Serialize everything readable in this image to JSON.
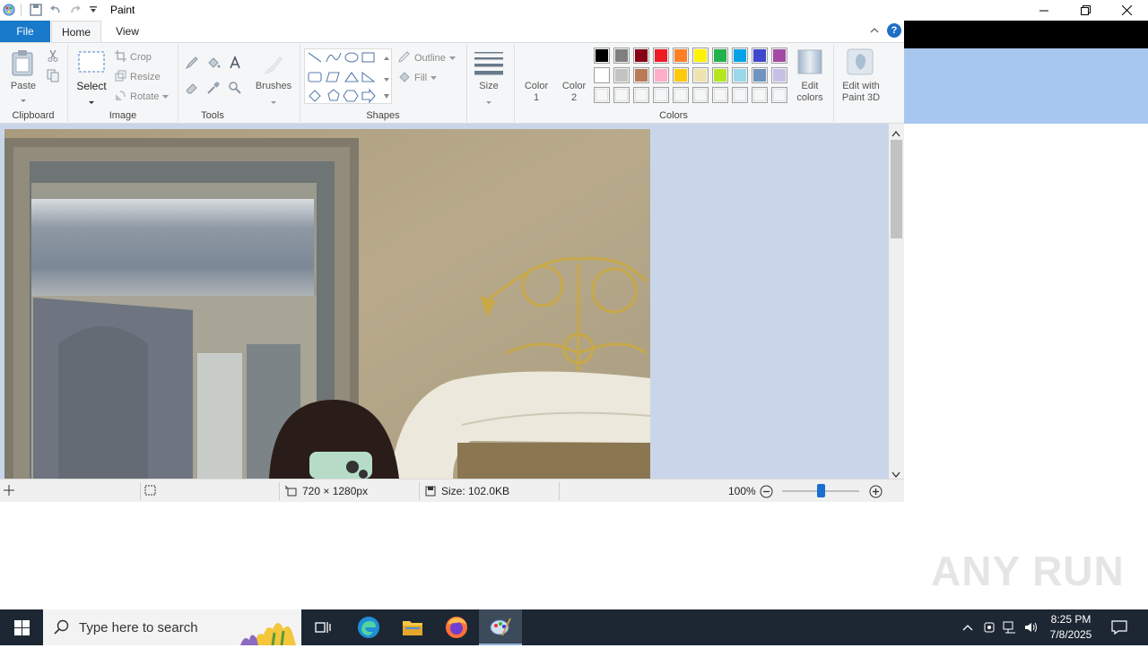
{
  "app": {
    "title": "Paint"
  },
  "tabs": {
    "file": "File",
    "home": "Home",
    "view": "View"
  },
  "ribbon": {
    "clipboard": {
      "paste": "Paste",
      "group": "Clipboard"
    },
    "image": {
      "select": "Select",
      "crop": "Crop",
      "resize": "Resize",
      "rotate": "Rotate",
      "group": "Image"
    },
    "tools": {
      "group": "Tools"
    },
    "brushes": {
      "label": "Brushes"
    },
    "shapes": {
      "outline": "Outline",
      "fill": "Fill",
      "group": "Shapes"
    },
    "size": {
      "label": "Size"
    },
    "colors": {
      "color1_line1": "Color",
      "color1_line2": "1",
      "color2_line1": "Color",
      "color2_line2": "2",
      "edit_line1": "Edit",
      "edit_line2": "colors",
      "paint3d_line1": "Edit with",
      "paint3d_line2": "Paint 3D",
      "group": "Colors",
      "palette_row1": [
        "#000000",
        "#7f7f7f",
        "#880015",
        "#ed1c24",
        "#ff7f27",
        "#fff200",
        "#22b14c",
        "#00a2e8",
        "#3f48cc",
        "#a349a4"
      ],
      "palette_row2": [
        "#ffffff",
        "#c3c3c3",
        "#b97a57",
        "#ffaec9",
        "#ffc90e",
        "#efe4b0",
        "#b5e61d",
        "#99d9ea",
        "#7092be",
        "#c8bfe7"
      ]
    }
  },
  "status": {
    "dimensions": "720 × 1280px",
    "size": "Size: 102.0KB",
    "zoom": "100%"
  },
  "taskbar": {
    "search_placeholder": "Type here to search",
    "time": "8:25 PM",
    "date": "7/8/2025"
  },
  "watermark": "ANY RUN",
  "icons": [
    "paint-app-icon",
    "save-icon",
    "undo-icon",
    "redo-icon",
    "customize-icon",
    "minimize-icon",
    "restore-icon",
    "close-icon",
    "help-icon",
    "collapse-ribbon-icon",
    "paste-icon",
    "cut-icon",
    "copy-icon",
    "select-icon",
    "crop-icon",
    "resize-icon",
    "rotate-icon",
    "pencil-icon",
    "fill-icon",
    "text-icon",
    "eraser-icon",
    "color-picker-icon",
    "magnifier-icon",
    "brushes-icon",
    "size-icon",
    "edit-colors-icon",
    "paint3d-icon",
    "zoom-out-icon",
    "zoom-in-icon",
    "windows-start-icon",
    "search-icon",
    "task-view-icon",
    "edge-icon",
    "file-explorer-icon",
    "firefox-icon",
    "paint-taskbar-icon",
    "notification-icon"
  ],
  "accent_colors": {
    "file_tab": "#1979ca",
    "taskbar": "#1d2733",
    "workarea": "#c9d6ea"
  }
}
